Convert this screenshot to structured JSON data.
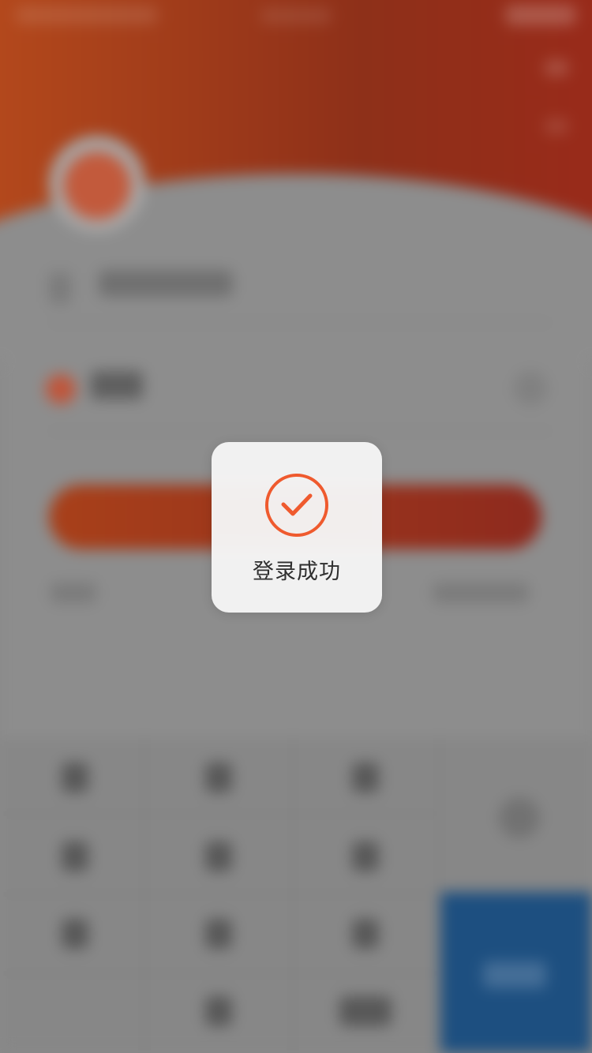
{
  "toast": {
    "message": "登录成功",
    "icon": "check-circle-icon",
    "accent_color": "#ef5a2e"
  },
  "background": {
    "blurred": true,
    "header_color": "#9a3a1c",
    "primary_button_color": "#9a3a1c",
    "confirm_key_color": "#1d4f80"
  }
}
